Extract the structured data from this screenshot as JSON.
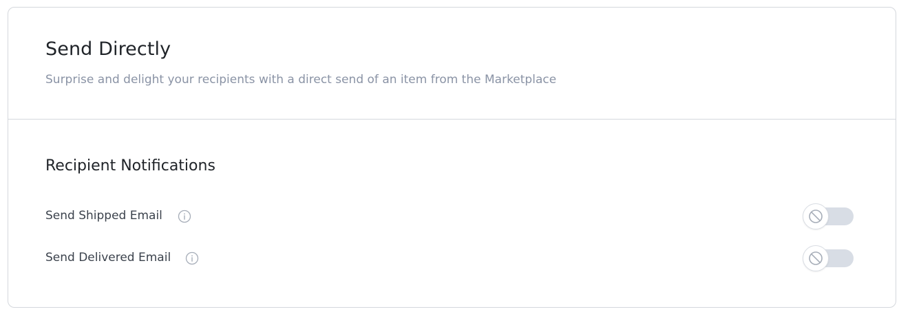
{
  "header": {
    "title": "Send Directly",
    "subtitle": "Surprise and delight your recipients with a direct send of an item from the Marketplace"
  },
  "notifications": {
    "title": "Recipient Notifications",
    "settings": [
      {
        "label": "Send Shipped Email",
        "info_icon": "info-icon",
        "toggle_state": "off",
        "toggle_icon": "disabled-icon"
      },
      {
        "label": "Send Delivered Email",
        "info_icon": "info-icon",
        "toggle_state": "off",
        "toggle_icon": "disabled-icon"
      }
    ]
  },
  "colors": {
    "title_text": "#1f2328",
    "subtitle_text": "#8a93a5",
    "label_text": "#3b424c",
    "border": "#d4d7dc",
    "toggle_track_off": "#d8dde5",
    "icon_gray": "#a6adb8"
  }
}
